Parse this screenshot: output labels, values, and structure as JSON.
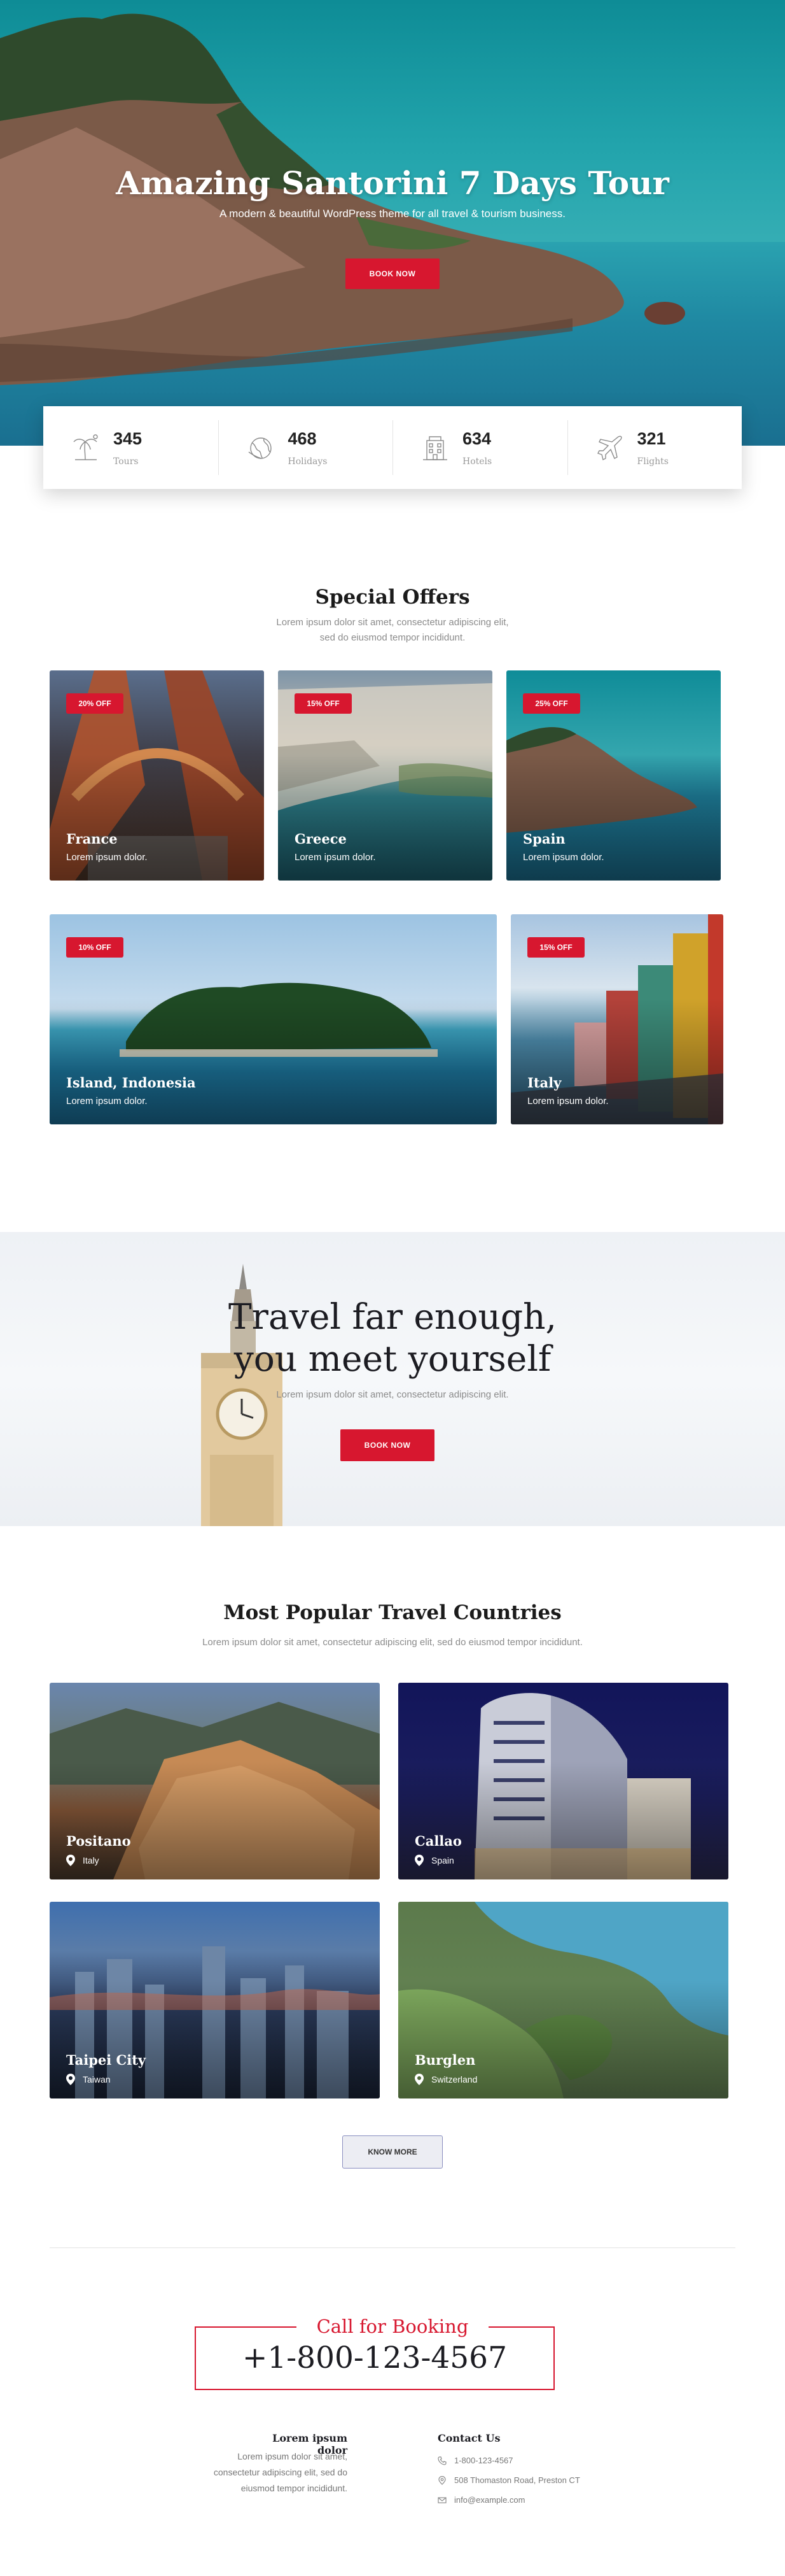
{
  "hero": {
    "title": "Amazing Santorini 7 Days Tour",
    "subtitle": "A modern & beautiful WordPress theme for all travel & tourism business.",
    "button": "BOOK NOW"
  },
  "stats": [
    {
      "icon": "palm-tree-icon",
      "value": "345",
      "label": "Tours"
    },
    {
      "icon": "globe-icon",
      "value": "468",
      "label": "Holidays"
    },
    {
      "icon": "hotel-icon",
      "value": "634",
      "label": "Hotels"
    },
    {
      "icon": "airplane-icon",
      "value": "321",
      "label": "Flights"
    }
  ],
  "offers": {
    "title": "Special Offers",
    "text_line1": "Lorem ipsum dolor sit amet, consectetur adipiscing elit,",
    "text_line2": "sed do eiusmod tempor incididunt.",
    "cards": [
      {
        "badge": "20% OFF",
        "name": "France",
        "sub": "Lorem ipsum dolor."
      },
      {
        "badge": "15% OFF",
        "name": "Greece",
        "sub": "Lorem ipsum dolor."
      },
      {
        "badge": "25% OFF",
        "name": "Spain",
        "sub": "Lorem ipsum dolor."
      },
      {
        "badge": "10% OFF",
        "name": "Island, Indonesia",
        "sub": "Lorem ipsum dolor."
      },
      {
        "badge": "15% OFF",
        "name": "Italy",
        "sub": "Lorem ipsum dolor."
      }
    ]
  },
  "quote": {
    "title_line1": "Travel far enough,",
    "title_line2": "you meet yourself",
    "text": "Lorem ipsum dolor sit amet, consectetur adipiscing elit.",
    "button": "BOOK NOW"
  },
  "popular": {
    "title": "Most Popular Travel Countries",
    "text": "Lorem ipsum dolor sit amet, consectetur adipiscing elit, sed do eiusmod tempor incididunt.",
    "cards": [
      {
        "name": "Positano",
        "location": "Italy"
      },
      {
        "name": "Callao",
        "location": "Spain"
      },
      {
        "name": "Taipei City",
        "location": "Taiwan"
      },
      {
        "name": "Burglen",
        "location": "Switzerland"
      }
    ],
    "button": "KNOW MORE"
  },
  "booking": {
    "label": "Call for Booking",
    "phone": "+1-800-123-4567"
  },
  "footer": {
    "about_title": "Lorem ipsum dolor",
    "about_line1": "Lorem ipsum dolor sit amet,",
    "about_line2": "consectetur adipiscing elit, sed do",
    "about_line3": "eiusmod tempor incididunt.",
    "contact_title": "Contact Us",
    "phone": "1-800-123-4567",
    "address": "508 Thomaston Road, Preston CT",
    "email": "info@example.com"
  },
  "colors": {
    "accent": "#d7172f",
    "text": "#1c1c22",
    "muted": "#8b8b8b"
  }
}
